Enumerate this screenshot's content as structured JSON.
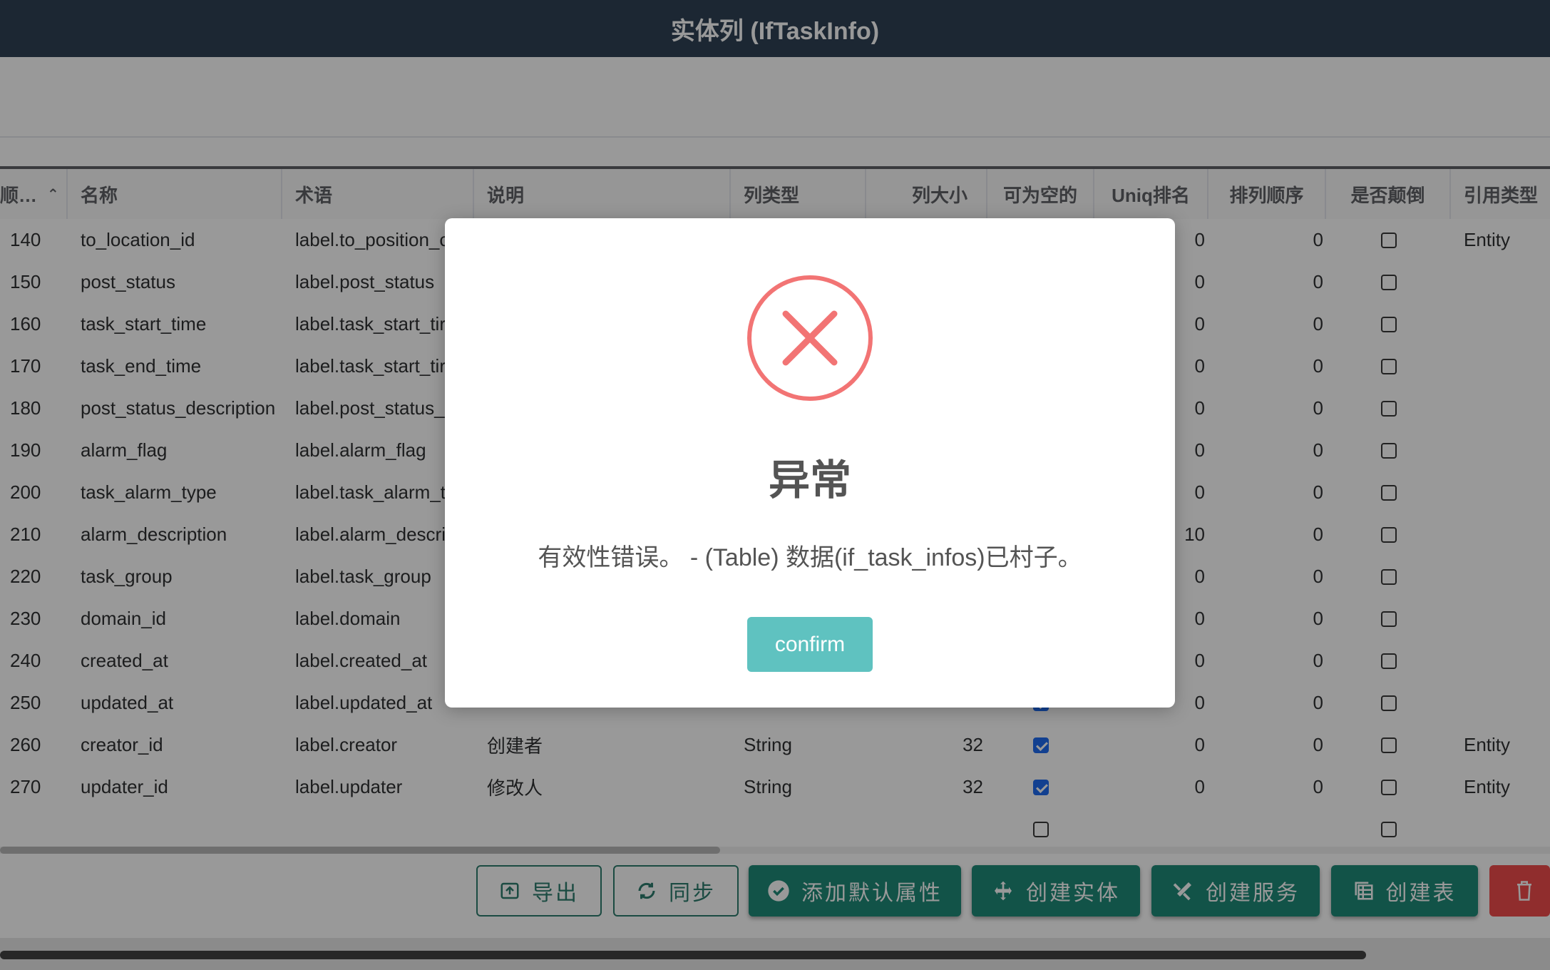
{
  "window": {
    "title": "实体列 (IfTaskInfo)"
  },
  "table": {
    "columns": {
      "order": "顺…",
      "name": "名称",
      "term": "术语",
      "desc": "说明",
      "type": "列类型",
      "size": "列大小",
      "nullable": "可为空的",
      "uniq": "Uniq排名",
      "sort": "排列顺序",
      "reverse": "是否颠倒",
      "ref": "引用类型"
    },
    "rows": [
      {
        "order": "140",
        "name": "to_location_id",
        "term": "label.to_position_c",
        "desc": "",
        "type": "",
        "size": "",
        "nullable": false,
        "uniq": "0",
        "sort": "0",
        "reverse": false,
        "ref": "Entity"
      },
      {
        "order": "150",
        "name": "post_status",
        "term": "label.post_status",
        "desc": "",
        "type": "",
        "size": "",
        "nullable": false,
        "uniq": "0",
        "sort": "0",
        "reverse": false,
        "ref": ""
      },
      {
        "order": "160",
        "name": "task_start_time",
        "term": "label.task_start_tir",
        "desc": "",
        "type": "",
        "size": "",
        "nullable": false,
        "uniq": "0",
        "sort": "0",
        "reverse": false,
        "ref": ""
      },
      {
        "order": "170",
        "name": "task_end_time",
        "term": "label.task_start_tir",
        "desc": "",
        "type": "",
        "size": "",
        "nullable": false,
        "uniq": "0",
        "sort": "0",
        "reverse": false,
        "ref": ""
      },
      {
        "order": "180",
        "name": "post_status_description",
        "term": "label.post_status_",
        "desc": "",
        "type": "",
        "size": "",
        "nullable": false,
        "uniq": "0",
        "sort": "0",
        "reverse": false,
        "ref": ""
      },
      {
        "order": "190",
        "name": "alarm_flag",
        "term": "label.alarm_flag",
        "desc": "",
        "type": "",
        "size": "",
        "nullable": false,
        "uniq": "0",
        "sort": "0",
        "reverse": false,
        "ref": ""
      },
      {
        "order": "200",
        "name": "task_alarm_type",
        "term": "label.task_alarm_t",
        "desc": "",
        "type": "",
        "size": "",
        "nullable": false,
        "uniq": "0",
        "sort": "0",
        "reverse": false,
        "ref": ""
      },
      {
        "order": "210",
        "name": "alarm_description",
        "term": "label.alarm_descri",
        "desc": "",
        "type": "",
        "size": "",
        "nullable": false,
        "uniq": "10",
        "sort": "0",
        "reverse": false,
        "ref": ""
      },
      {
        "order": "220",
        "name": "task_group",
        "term": "label.task_group",
        "desc": "",
        "type": "",
        "size": "",
        "nullable": false,
        "uniq": "0",
        "sort": "0",
        "reverse": false,
        "ref": ""
      },
      {
        "order": "230",
        "name": "domain_id",
        "term": "label.domain",
        "desc": "",
        "type": "",
        "size": "",
        "nullable": false,
        "uniq": "0",
        "sort": "0",
        "reverse": false,
        "ref": ""
      },
      {
        "order": "240",
        "name": "created_at",
        "term": "label.created_at",
        "desc": "",
        "type": "",
        "size": "",
        "nullable": false,
        "uniq": "0",
        "sort": "0",
        "reverse": false,
        "ref": ""
      },
      {
        "order": "250",
        "name": "updated_at",
        "term": "label.updated_at",
        "desc": "",
        "type": "",
        "size": "",
        "nullable": true,
        "uniq": "0",
        "sort": "0",
        "reverse": false,
        "ref": ""
      },
      {
        "order": "260",
        "name": "creator_id",
        "term": "label.creator",
        "desc": "创建者",
        "type": "String",
        "size": "32",
        "nullable": true,
        "uniq": "0",
        "sort": "0",
        "reverse": false,
        "ref": "Entity"
      },
      {
        "order": "270",
        "name": "updater_id",
        "term": "label.updater",
        "desc": "修改人",
        "type": "String",
        "size": "32",
        "nullable": true,
        "uniq": "0",
        "sort": "0",
        "reverse": false,
        "ref": "Entity"
      },
      {
        "order": "",
        "name": "",
        "term": "",
        "desc": "",
        "type": "",
        "size": "",
        "nullable": false,
        "uniq": "",
        "sort": "",
        "reverse": false,
        "ref": ""
      }
    ]
  },
  "footer": {
    "buttons": [
      {
        "label": "导出",
        "icon": "export-icon",
        "style": "outline"
      },
      {
        "label": "同步",
        "icon": "sync-icon",
        "style": "outline"
      },
      {
        "label": "添加默认属性",
        "icon": "check-circle-icon",
        "style": "solid"
      },
      {
        "label": "创建实体",
        "icon": "move-icon",
        "style": "solid"
      },
      {
        "label": "创建服务",
        "icon": "tools-icon",
        "style": "solid"
      },
      {
        "label": "创建表",
        "icon": "table-icon",
        "style": "solid"
      },
      {
        "label": "",
        "icon": "trash-icon",
        "style": "danger"
      }
    ]
  },
  "dialog": {
    "icon": "error-icon",
    "title": "异常",
    "message": "有效性错误。 - (Table) 数据(if_task_infos)已村子。",
    "confirm_label": "confirm"
  },
  "colors": {
    "titlebar": "#304156",
    "primary_button": "#1f8a78",
    "confirm_button": "#5fc2c0",
    "error_icon": "#f27474"
  }
}
